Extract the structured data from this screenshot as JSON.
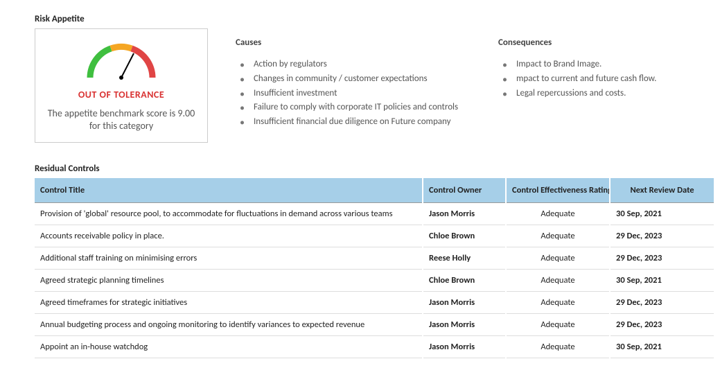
{
  "riskAppetite": {
    "title": "Risk Appetite",
    "status": "OUT OF TOLERANCE",
    "description": "The appetite benchmark score is 9.00 for this category"
  },
  "causes": {
    "title": "Causes",
    "items": [
      "Action by regulators",
      "Changes in community / customer expectations",
      "Insufficient investment",
      "Failure to comply with corporate IT policies and controls",
      "Insufficient financial due diligence on Future company"
    ]
  },
  "consequences": {
    "title": "Consequences",
    "items": [
      "Impact to Brand Image.",
      "mpact to current and future cash flow.",
      "Legal repercussions and costs."
    ]
  },
  "controls": {
    "title": "Residual Controls",
    "headers": {
      "controlTitle": "Control Title",
      "controlOwner": "Control Owner",
      "effectiveness": "Control Effectiveness Rating",
      "nextReview": "Next Review Date"
    },
    "rows": [
      {
        "title": "Provision of 'global' resource pool, to accommodate for fluctuations in demand across various teams",
        "owner": "Jason Morris",
        "rating": "Adequate",
        "date": "30 Sep, 2021"
      },
      {
        "title": "Accounts receivable policy in place.",
        "owner": "Chloe Brown",
        "rating": "Adequate",
        "date": "29 Dec, 2023"
      },
      {
        "title": "Additional staff training on minimising errors",
        "owner": "Reese Holly",
        "rating": "Adequate",
        "date": "29 Dec, 2023"
      },
      {
        "title": "Agreed strategic planning timelines",
        "owner": "Chloe Brown",
        "rating": "Adequate",
        "date": "30 Sep, 2021"
      },
      {
        "title": "Agreed timeframes for strategic initiatives",
        "owner": "Jason Morris",
        "rating": "Adequate",
        "date": "29 Dec, 2023"
      },
      {
        "title": "Annual budgeting process and ongoing monitoring to identify variances to expected revenue",
        "owner": "Jason Morris",
        "rating": "Adequate",
        "date": "29 Dec, 2023"
      },
      {
        "title": "Appoint an in-house watchdog",
        "owner": "Jason Morris",
        "rating": "Adequate",
        "date": "30 Sep, 2021"
      }
    ]
  }
}
